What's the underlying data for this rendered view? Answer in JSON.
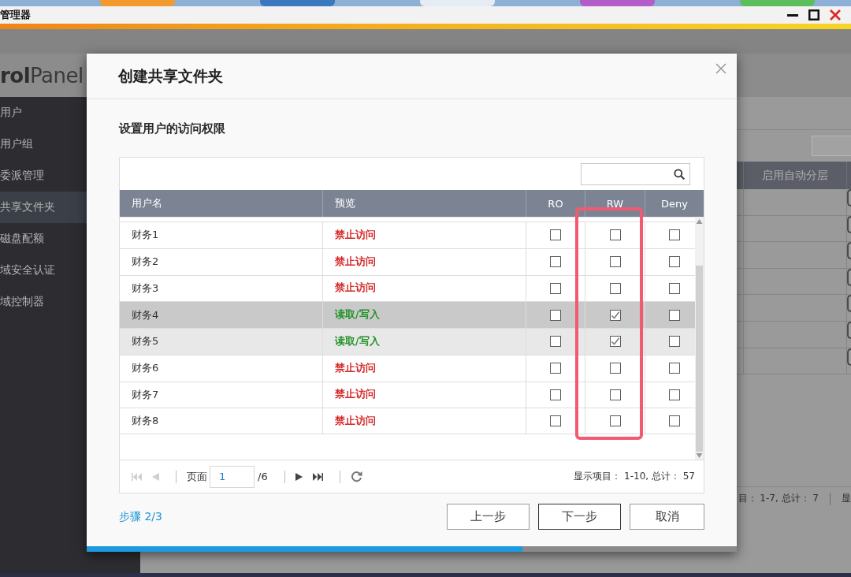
{
  "desktop": {
    "tiles": [
      {
        "color": "#f29a2e"
      },
      {
        "color": "#3a78bf"
      },
      {
        "color": "#e6ecf4"
      },
      {
        "color": "#b45cc8"
      },
      {
        "color": "#5cbf5c"
      }
    ]
  },
  "window": {
    "title": "管理器"
  },
  "panel": {
    "title": "**rol**Panel",
    "sidebar": {
      "items": [
        {
          "label": "用户",
          "selected": false
        },
        {
          "label": "用户组",
          "selected": false
        },
        {
          "label": "委派管理",
          "selected": false
        },
        {
          "label": "共享文件夹",
          "selected": true
        },
        {
          "label": "磁盘配额",
          "selected": false
        },
        {
          "label": "域安全认证",
          "selected": false
        },
        {
          "label": "域控制器",
          "selected": false
        }
      ]
    },
    "table": {
      "columns": [
        "启用自动分层"
      ],
      "rows": [
        {
          "button": true
        },
        {
          "button": true
        },
        {
          "button": true
        },
        {
          "button": true
        },
        {
          "button": true
        },
        {
          "button": true
        },
        {
          "button": true
        }
      ]
    },
    "status": "目： 1-7, 总计： 7",
    "status_more": "显"
  },
  "dialog": {
    "title": "创建共享文件夹",
    "subtitle": "设置用户的访问权限",
    "table": {
      "columns": [
        {
          "label": "用户名",
          "kind": "text",
          "highlighted": false
        },
        {
          "label": "预览",
          "kind": "text",
          "highlighted": false
        },
        {
          "label": "RO",
          "kind": "check",
          "highlighted": false
        },
        {
          "label": "RW",
          "kind": "check",
          "highlighted": true
        },
        {
          "label": "Deny",
          "kind": "check",
          "highlighted": false
        }
      ],
      "rows": [
        {
          "name": "财务1",
          "access": {
            "text": "禁止访问",
            "color": "#d42a2a"
          },
          "selected": false,
          "hovered": false,
          "checks": [
            false,
            false,
            false
          ]
        },
        {
          "name": "财务2",
          "access": {
            "text": "禁止访问",
            "color": "#d42a2a"
          },
          "selected": false,
          "hovered": false,
          "checks": [
            false,
            false,
            false
          ]
        },
        {
          "name": "财务3",
          "access": {
            "text": "禁止访问",
            "color": "#d42a2a"
          },
          "selected": false,
          "hovered": false,
          "checks": [
            false,
            false,
            false
          ]
        },
        {
          "name": "财务4",
          "access": {
            "text": "读取/写入",
            "color": "#23922a"
          },
          "selected": true,
          "hovered": false,
          "checks": [
            false,
            true,
            false
          ]
        },
        {
          "name": "财务5",
          "access": {
            "text": "读取/写入",
            "color": "#23922a"
          },
          "selected": false,
          "hovered": true,
          "checks": [
            false,
            true,
            false
          ]
        },
        {
          "name": "财务6",
          "access": {
            "text": "禁止访问",
            "color": "#d42a2a"
          },
          "selected": false,
          "hovered": false,
          "checks": [
            false,
            false,
            false
          ]
        },
        {
          "name": "财务7",
          "access": {
            "text": "禁止访问",
            "color": "#d42a2a"
          },
          "selected": false,
          "hovered": false,
          "checks": [
            false,
            false,
            false
          ]
        },
        {
          "name": "财务8",
          "access": {
            "text": "禁止访问",
            "color": "#d42a2a"
          },
          "selected": false,
          "hovered": false,
          "checks": [
            false,
            false,
            false
          ]
        }
      ]
    },
    "pager": {
      "back": [
        {
          "kind": "first",
          "disabled": true
        },
        {
          "kind": "prev",
          "disabled": true
        }
      ],
      "page_label": "页面",
      "page": "1",
      "page_total": "/6",
      "forward": [
        {
          "kind": "next",
          "disabled": false
        },
        {
          "kind": "last",
          "disabled": false
        }
      ],
      "summary": "显示项目： 1-10, 总计： 57"
    },
    "step": "步骤 2/3",
    "buttons": [
      {
        "label": "上一步",
        "kind": "secondary"
      },
      {
        "label": "下一步",
        "kind": "primary"
      },
      {
        "label": "取消",
        "kind": "secondary"
      }
    ],
    "progress": {
      "level": 0.67
    }
  }
}
